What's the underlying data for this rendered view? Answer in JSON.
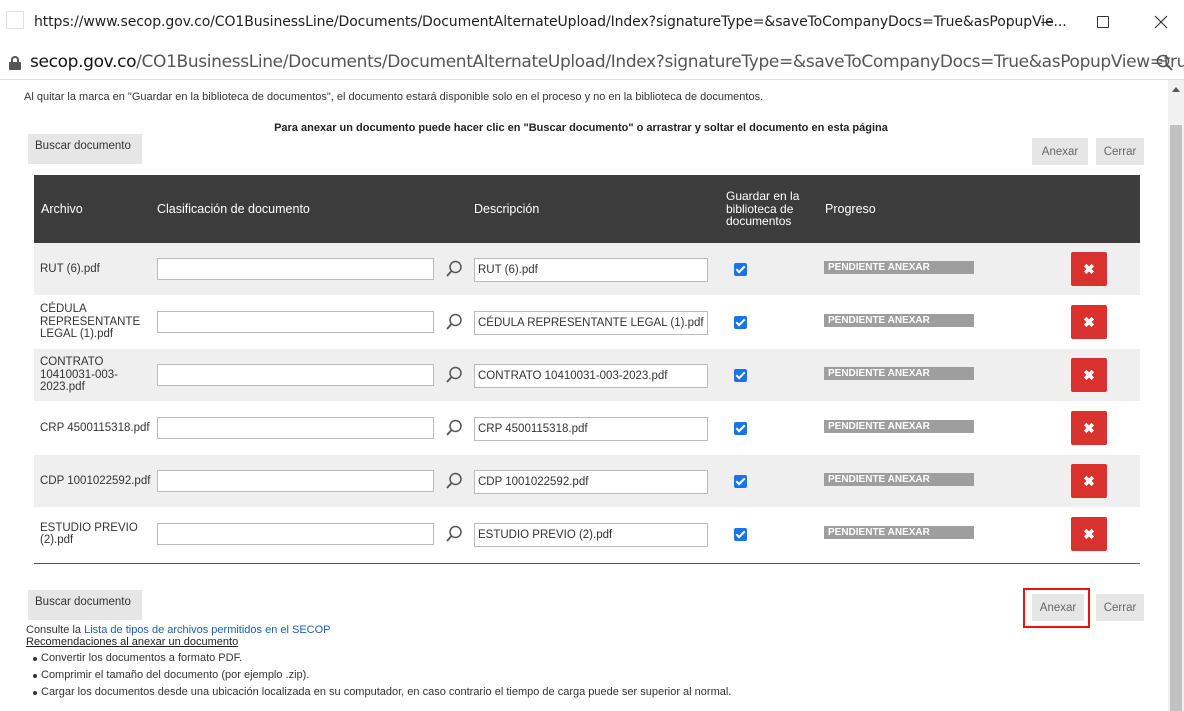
{
  "window": {
    "title": "https://www.secop.gov.co/CO1BusinessLine/Documents/DocumentAlternateUpload/Index?signatureType=&saveToCompanyDocs=True&asPopupVie..."
  },
  "address": {
    "domain": "secop.gov.co",
    "path": "/CO1BusinessLine/Documents/DocumentAlternateUpload/Index?signatureType=&saveToCompanyDocs=True&asPopupView=true..."
  },
  "page": {
    "notice": "Al quitar la marca en \"Guardar en la biblioteca de documentos\", el documento estará disponible solo en el proceso y no en la biblioteca de documentos.",
    "instruction": "Para anexar un documento puede hacer clic en \"Buscar documento\" o arrastrar y soltar el documento en esta página",
    "buscar_label": "Buscar documento",
    "anexar_label": "Anexar",
    "cerrar_label": "Cerrar"
  },
  "table": {
    "headers": {
      "archivo": "Archivo",
      "clasificacion": "Clasificación de documento",
      "descripcion": "Descripción",
      "guardar": "Guardar en la biblioteca de documentos",
      "progreso": "Progreso"
    },
    "rows": [
      {
        "file": "RUT (6).pdf",
        "description": "RUT (6).pdf",
        "saved": true,
        "status": "PENDIENTE ANEXAR"
      },
      {
        "file": "CÉDULA REPRESENTANTE LEGAL (1).pdf",
        "description": "CÉDULA REPRESENTANTE LEGAL (1).pdf",
        "saved": true,
        "status": "PENDIENTE ANEXAR"
      },
      {
        "file": "CONTRATO 10410031-003-2023.pdf",
        "description": "CONTRATO 10410031-003-2023.pdf",
        "saved": true,
        "status": "PENDIENTE ANEXAR"
      },
      {
        "file": "CRP 4500115318.pdf",
        "description": "CRP 4500115318.pdf",
        "saved": true,
        "status": "PENDIENTE ANEXAR"
      },
      {
        "file": "CDP 1001022592.pdf",
        "description": "CDP 1001022592.pdf",
        "saved": true,
        "status": "PENDIENTE ANEXAR"
      },
      {
        "file": "ESTUDIO PREVIO (2).pdf",
        "description": "ESTUDIO PREVIO (2).pdf",
        "saved": true,
        "status": "PENDIENTE ANEXAR"
      }
    ]
  },
  "footer": {
    "consulte_prefix": "Consulte la",
    "consulte_link": "Lista de tipos de archivos permitidos en el SECOP",
    "recommendations_title": "Recomendaciones al anexar un documento",
    "tips": [
      "Convertir los documentos a formato PDF.",
      "Comprimir el tamaño del documento (por ejemplo .zip).",
      "Cargar los documentos desde una ubicación localizada en su computador, en caso contrario el tiempo de carga puede ser superior al normal."
    ]
  },
  "colors": {
    "header_bg": "#3c3c3c",
    "delete_red": "#d9312e",
    "checkbox_blue": "#1a73e8",
    "highlight_red": "#ee1111",
    "progress_gray": "#9e9e9e"
  },
  "icons": [
    "page-icon",
    "minimize-icon",
    "maximize-icon",
    "close-icon",
    "lock-icon",
    "zoom-icon",
    "search-icon",
    "check-icon",
    "delete-icon"
  ]
}
